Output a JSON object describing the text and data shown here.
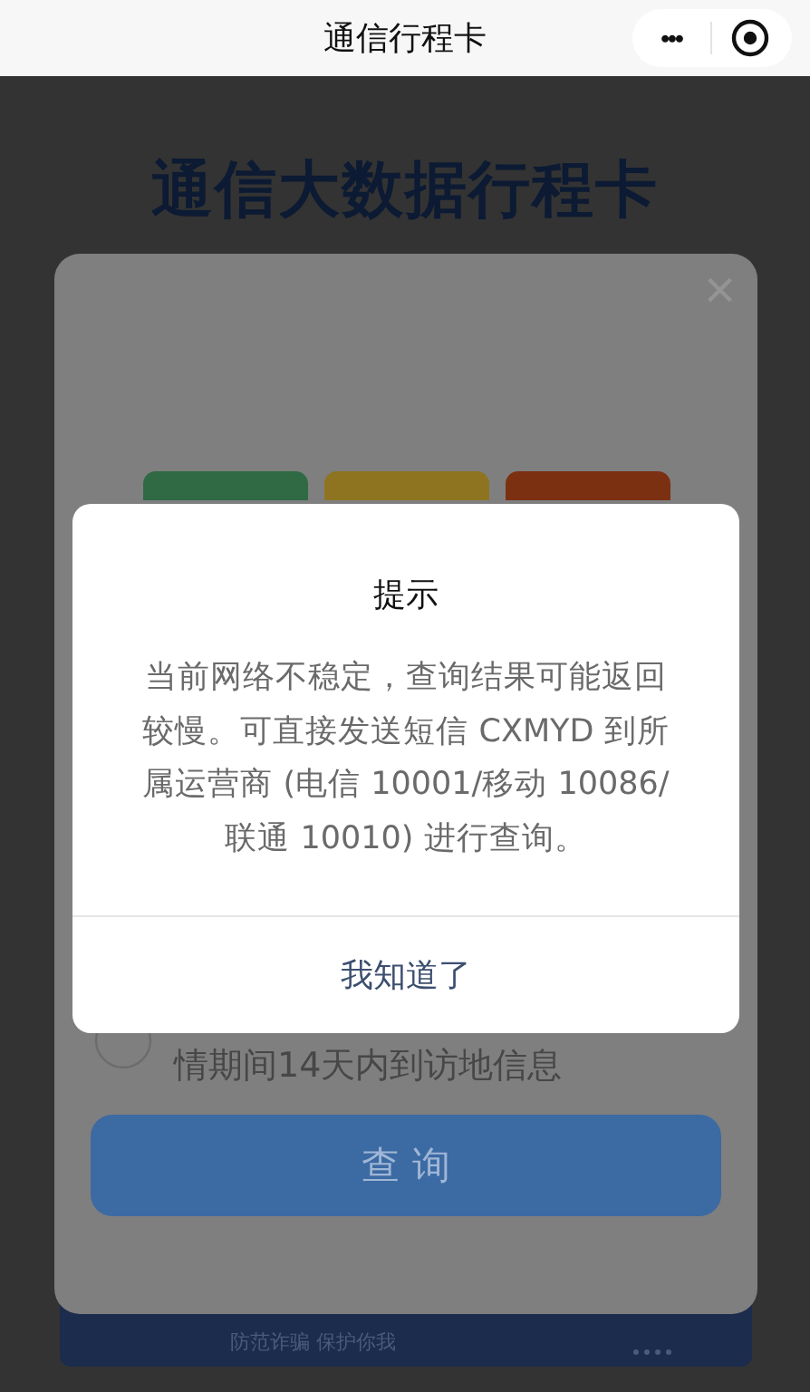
{
  "nav_bar": {
    "title": "通信行程卡",
    "more": "•••"
  },
  "page": {
    "title": "通信大数据行程卡",
    "footer": "防范诈骗 保护你我"
  },
  "card": {
    "close": "×",
    "consent_text": "情期间14天内到访地信息",
    "query_button": "查 询"
  },
  "dialog": {
    "title": "提示",
    "message": "当前网络不稳定，查询结果可能返回较慢。可直接发送短信 CXMYD 到所属运营商 (电信 10001/移动 10086/联通 10010) 进行查询。",
    "buttons": [
      "我知道了"
    ]
  }
}
